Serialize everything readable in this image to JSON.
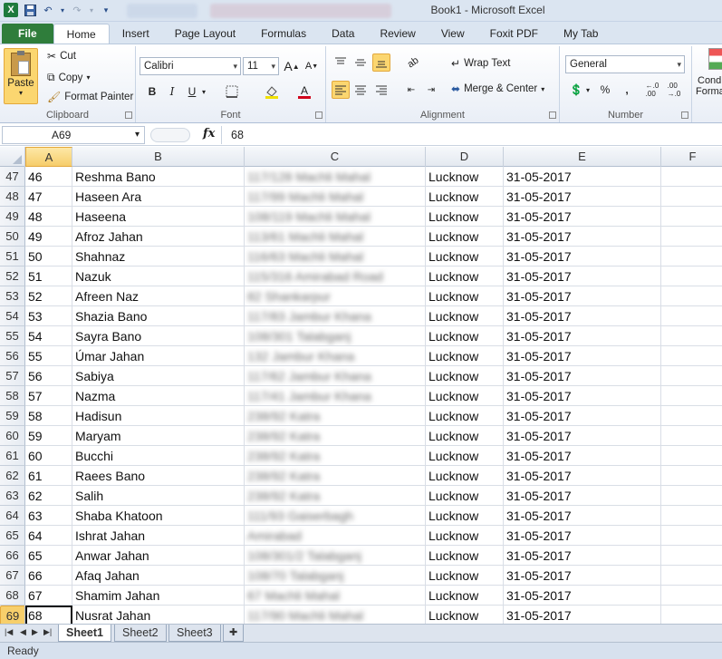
{
  "app": {
    "title": "Book1 - Microsoft Excel"
  },
  "ribbon": {
    "tabs": [
      "File",
      "Home",
      "Insert",
      "Page Layout",
      "Formulas",
      "Data",
      "Review",
      "View",
      "Foxit PDF",
      "My Tab"
    ],
    "clipboard": {
      "label": "Clipboard",
      "paste": "Paste",
      "cut": "Cut",
      "copy": "Copy",
      "format_painter": "Format Painter"
    },
    "font": {
      "label": "Font",
      "name": "Calibri",
      "size": "11"
    },
    "alignment": {
      "label": "Alignment",
      "wrap_text": "Wrap Text",
      "merge_center": "Merge & Center"
    },
    "number": {
      "label": "Number",
      "format": "General"
    },
    "styles": {
      "cond_line1": "Cond",
      "cond_line2": "Forma"
    }
  },
  "formula_bar": {
    "name_box": "A69",
    "fx": "fx",
    "content": "68"
  },
  "grid": {
    "columns": [
      "A",
      "B",
      "C",
      "D",
      "E",
      "F"
    ],
    "rows": [
      {
        "row": "47",
        "a": "46",
        "b": "Reshma Bano",
        "c": "117/128 Machli Mahal",
        "d": "Lucknow",
        "e": "31-05-2017"
      },
      {
        "row": "48",
        "a": "47",
        "b": "Haseen Ara",
        "c": "117/99 Machli Mahal",
        "d": "Lucknow",
        "e": "31-05-2017"
      },
      {
        "row": "49",
        "a": "48",
        "b": "Haseena",
        "c": "108/119 Machli Mahal",
        "d": "Lucknow",
        "e": "31-05-2017"
      },
      {
        "row": "50",
        "a": "49",
        "b": "Afroz Jahan",
        "c": "113/61 Machli Mahal",
        "d": "Lucknow",
        "e": "31-05-2017"
      },
      {
        "row": "51",
        "a": "50",
        "b": "Shahnaz",
        "c": "116/63 Machli Mahal",
        "d": "Lucknow",
        "e": "31-05-2017"
      },
      {
        "row": "52",
        "a": "51",
        "b": "Nazuk",
        "c": "115/316 Amirabad Road",
        "d": "Lucknow",
        "e": "31-05-2017"
      },
      {
        "row": "53",
        "a": "52",
        "b": "Afreen Naz",
        "c": "82 Shankarpur",
        "d": "Lucknow",
        "e": "31-05-2017"
      },
      {
        "row": "54",
        "a": "53",
        "b": "Shazia Bano",
        "c": "117/83 Jambur Khana",
        "d": "Lucknow",
        "e": "31-05-2017"
      },
      {
        "row": "55",
        "a": "54",
        "b": "Sayra Bano",
        "c": "108/301 Talabganj",
        "d": "Lucknow",
        "e": "31-05-2017"
      },
      {
        "row": "56",
        "a": "55",
        "b": "Úmar Jahan",
        "c": "132 Jambur Khana",
        "d": "Lucknow",
        "e": "31-05-2017"
      },
      {
        "row": "57",
        "a": "56",
        "b": "Sabiya",
        "c": "117/62 Jambur Khana",
        "d": "Lucknow",
        "e": "31-05-2017"
      },
      {
        "row": "58",
        "a": "57",
        "b": "Nazma",
        "c": "117/41 Jambur Khana",
        "d": "Lucknow",
        "e": "31-05-2017"
      },
      {
        "row": "59",
        "a": "58",
        "b": "Hadisun",
        "c": "238/92 Katra",
        "d": "Lucknow",
        "e": "31-05-2017"
      },
      {
        "row": "60",
        "a": "59",
        "b": "Maryam",
        "c": "238/92 Katra",
        "d": "Lucknow",
        "e": "31-05-2017"
      },
      {
        "row": "61",
        "a": "60",
        "b": "Bucchi",
        "c": "238/92 Katra",
        "d": "Lucknow",
        "e": "31-05-2017"
      },
      {
        "row": "62",
        "a": "61",
        "b": "Raees Bano",
        "c": "238/92 Katra",
        "d": "Lucknow",
        "e": "31-05-2017"
      },
      {
        "row": "63",
        "a": "62",
        "b": "Salih",
        "c": "238/92 Katra",
        "d": "Lucknow",
        "e": "31-05-2017"
      },
      {
        "row": "64",
        "a": "63",
        "b": "Shaba Khatoon",
        "c": "111/93 Gaiserbagh",
        "d": "Lucknow",
        "e": "31-05-2017"
      },
      {
        "row": "65",
        "a": "64",
        "b": "Ishrat Jahan",
        "c": "Amirabad",
        "d": "Lucknow",
        "e": "31-05-2017"
      },
      {
        "row": "66",
        "a": "65",
        "b": "Anwar Jahan",
        "c": "108/301/2 Talabganj",
        "d": "Lucknow",
        "e": "31-05-2017"
      },
      {
        "row": "67",
        "a": "66",
        "b": "Afaq Jahan",
        "c": "108/70 Talabganj",
        "d": "Lucknow",
        "e": "31-05-2017"
      },
      {
        "row": "68",
        "a": "67",
        "b": "Shamim Jahan",
        "c": "67 Machli Mahal",
        "d": "Lucknow",
        "e": "31-05-2017"
      },
      {
        "row": "69",
        "a": "68",
        "b": "Nusrat Jahan",
        "c": "117/90 Machli Mahal",
        "d": "Lucknow",
        "e": "31-05-2017"
      }
    ]
  },
  "sheets": [
    "Sheet1",
    "Sheet2",
    "Sheet3"
  ],
  "status": {
    "text": "Ready"
  }
}
